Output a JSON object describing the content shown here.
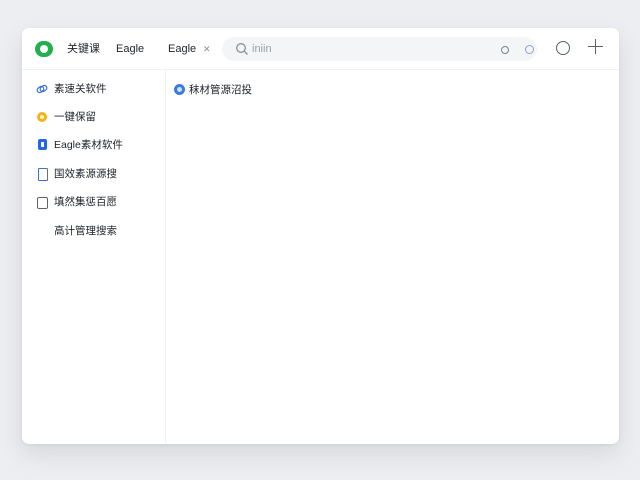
{
  "titlebar": {
    "tabs": [
      {
        "label": "关键课"
      },
      {
        "label": "Eagle"
      },
      {
        "label": "Eagle"
      }
    ],
    "tab_close": "✕",
    "search": {
      "placeholder": "iniin"
    }
  },
  "sidebar": {
    "items": [
      {
        "label": "素速关软件",
        "icon": "link-icon"
      },
      {
        "label": "一键保留",
        "icon": "smile-icon"
      },
      {
        "label": "Eagle素材软件",
        "icon": "app-icon"
      },
      {
        "label": "国效素源源搜",
        "icon": "document-icon"
      },
      {
        "label": "填然集惩百愿",
        "icon": "file-icon"
      },
      {
        "label": "高计管理搜索",
        "icon": ""
      }
    ]
  },
  "main": {
    "title": "秣材管源沼投",
    "title_icon": "circle-icon"
  },
  "colors": {
    "logo": "#21b04b",
    "accent_blue": "#2a62e6",
    "accent_yellow": "#f6b21c"
  }
}
